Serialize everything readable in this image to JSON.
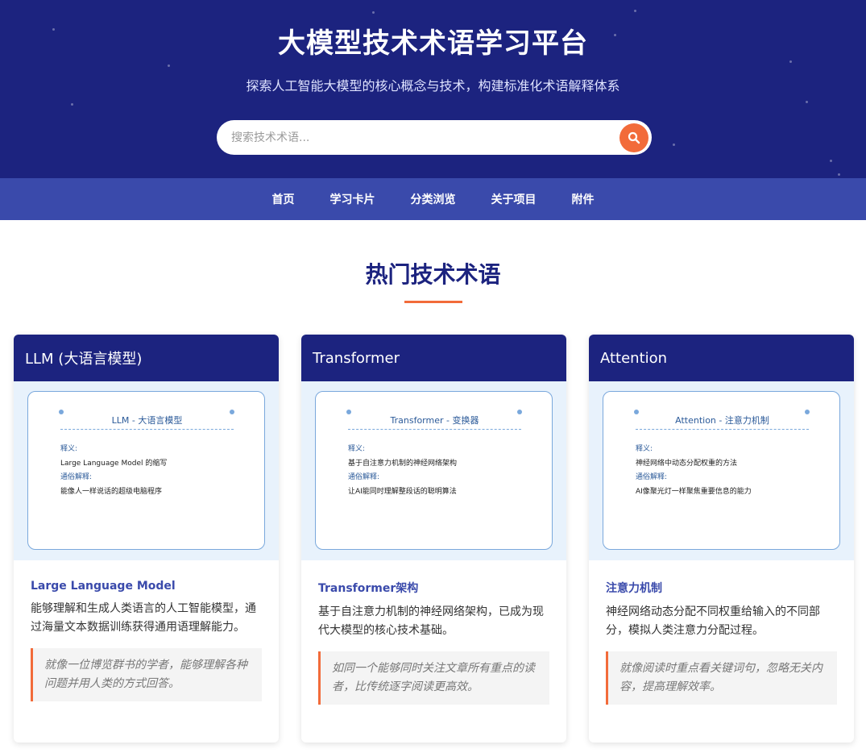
{
  "header": {
    "title": "大模型技术术语学习平台",
    "subtitle": "探索人工智能大模型的核心概念与技术，构建标准化术语解释体系"
  },
  "search": {
    "placeholder": "搜索技术术语..."
  },
  "nav": {
    "items": [
      {
        "label": "首页"
      },
      {
        "label": "学习卡片"
      },
      {
        "label": "分类浏览"
      },
      {
        "label": "关于项目"
      },
      {
        "label": "附件"
      }
    ]
  },
  "section": {
    "title": "热门技术术语"
  },
  "cards": [
    {
      "header": "LLM (大语言模型)",
      "preview": {
        "title": "LLM - 大语言模型",
        "def_label": "释义:",
        "def_text": "Large Language Model 的缩写",
        "plain_label": "通俗解释:",
        "plain_text": "能像人一样说话的超级电脑程序"
      },
      "subtitle": "Large Language Model",
      "description": "能够理解和生成人类语言的人工智能模型，通过海量文本数据训练获得通用语理解能力。",
      "quote": "就像一位博览群书的学者，能够理解各种问题并用人类的方式回答。"
    },
    {
      "header": "Transformer",
      "preview": {
        "title": "Transformer - 变换器",
        "def_label": "释义:",
        "def_text": "基于自注意力机制的神经网络架构",
        "plain_label": "通俗解释:",
        "plain_text": "让AI能同时理解整段话的聪明算法"
      },
      "subtitle": "Transformer架构",
      "description": "基于自注意力机制的神经网络架构，已成为现代大模型的核心技术基础。",
      "quote": "如同一个能够同时关注文章所有重点的读者，比传统逐字阅读更高效。"
    },
    {
      "header": "Attention",
      "preview": {
        "title": "Attention - 注意力机制",
        "def_label": "释义:",
        "def_text": "神经网络中动态分配权重的方法",
        "plain_label": "通俗解释:",
        "plain_text": "AI像聚光灯一样聚焦重要信息的能力"
      },
      "subtitle": "注意力机制",
      "description": "神经网络动态分配不同权重给输入的不同部分，模拟人类注意力分配过程。",
      "quote": "就像阅读时重点看关键词句，忽略无关内容，提高理解效率。"
    }
  ],
  "colors": {
    "hero_bg": "#1c237f",
    "nav_bg": "#3a4aab",
    "accent": "#f26b3a",
    "preview_bg": "#e8f2fc"
  },
  "icons": {
    "search_button": "search-icon"
  }
}
